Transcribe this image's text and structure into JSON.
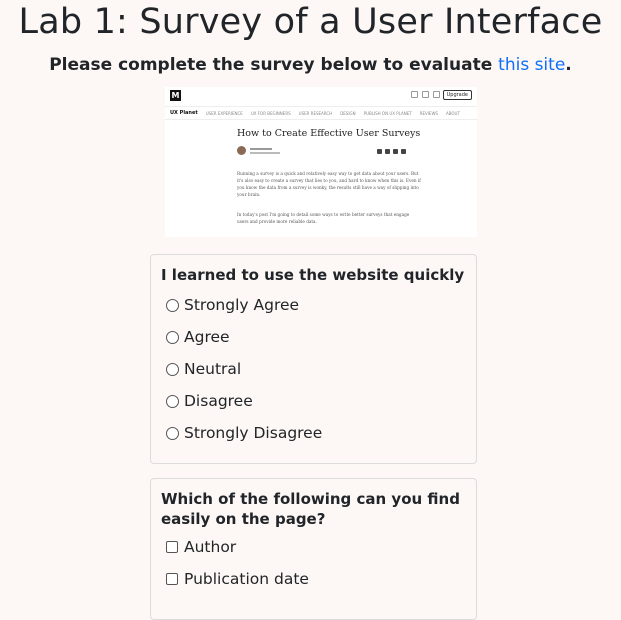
{
  "header": {
    "title": "Lab 1: Survey of a User Interface",
    "subtitle_text": "Please complete the survey below to evaluate ",
    "subtitle_link": "this site",
    "subtitle_end": "."
  },
  "screenshot": {
    "logo": "M",
    "upgrade": "Upgrade",
    "brand": "UX Planet",
    "nav_items": [
      "USER EXPERIENCE",
      "UX FOR BEGINNERS",
      "USER RESEARCH",
      "DESIGN",
      "PUBLISH ON UX PLANET",
      "REVIEWS",
      "ABOUT"
    ],
    "article_title": "How to Create Effective User Surveys",
    "para1": "Running a survey is a quick and relatively easy way to get data about your users. But it's also easy to create a survey that lies to you, and hard to know when this is. Even if you know the data from a survey is wonky, the results still have a way of slipping into your brain.",
    "para2": "In today's post I'm going to detail some ways to write better surveys that engage users and provide more reliable data."
  },
  "question1": {
    "title": "I learned to use the website quickly",
    "options": [
      "Strongly Agree",
      "Agree",
      "Neutral",
      "Disagree",
      "Strongly Disagree"
    ]
  },
  "question2": {
    "title": "Which of the following can you find easily on the page?",
    "options": [
      "Author",
      "Publication date"
    ]
  }
}
